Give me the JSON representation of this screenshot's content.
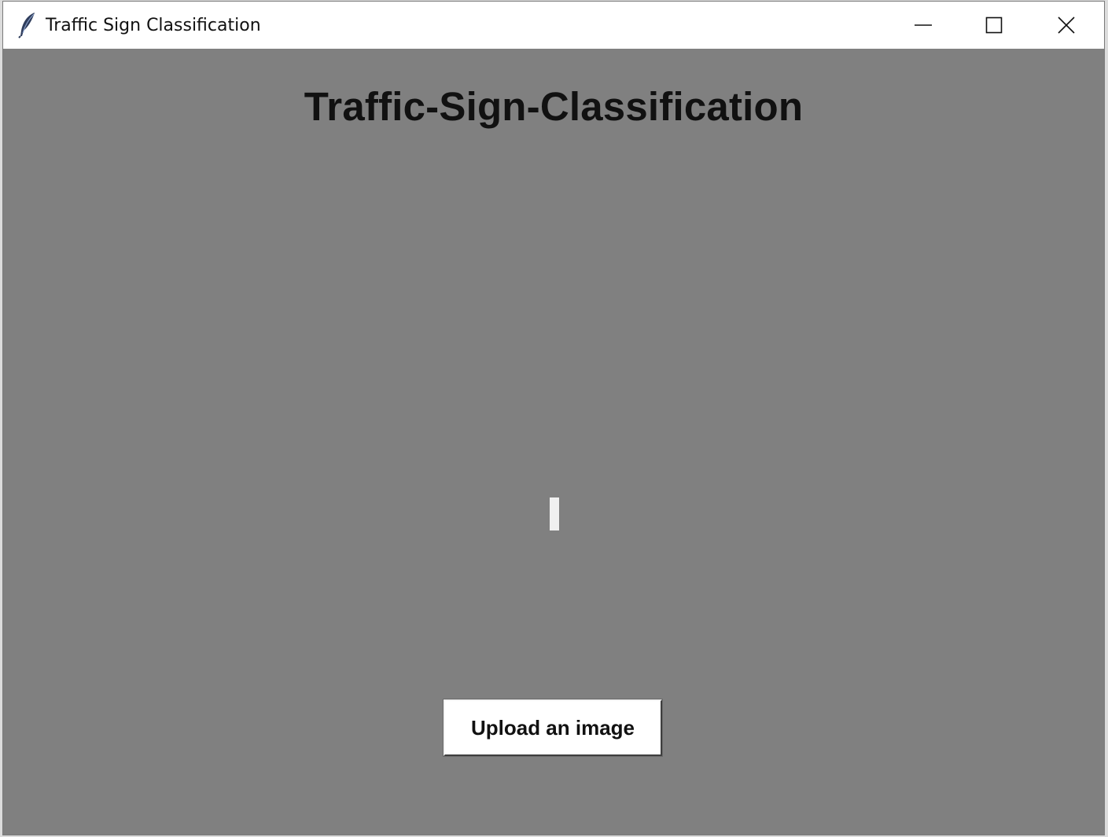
{
  "window": {
    "title": "Traffic Sign Classification",
    "app_icon": "feather-icon",
    "controls": {
      "minimize_icon": "minimize-icon",
      "maximize_icon": "maximize-icon",
      "close_icon": "close-icon"
    }
  },
  "main": {
    "heading": "Traffic-Sign-Classification",
    "upload_button_label": "Upload an image"
  },
  "colors": {
    "content_background": "#808080",
    "titlebar_background": "#ffffff",
    "button_background": "#ffffff",
    "text": "#111111"
  }
}
